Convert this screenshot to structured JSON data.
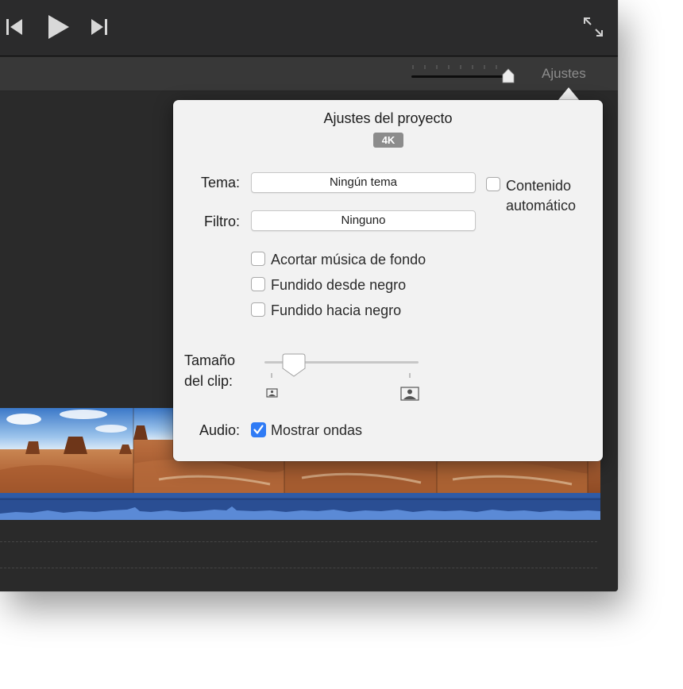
{
  "toolbar": {
    "icons": [
      "skip-back-icon",
      "play-icon",
      "skip-forward-icon",
      "fullscreen-icon"
    ]
  },
  "subbar": {
    "settings_label": "Ajustes",
    "zoom_level": 1.0
  },
  "popover": {
    "title": "Ajustes del proyecto",
    "badge": "4K",
    "theme_label": "Tema:",
    "theme_value": "Ningún tema",
    "filter_label": "Filtro:",
    "filter_value": "Ninguno",
    "auto_content_line1": "Contenido",
    "auto_content_line2": "automático",
    "auto_content_checked": false,
    "options": [
      {
        "label": "Acortar música de fondo",
        "checked": false
      },
      {
        "label": "Fundido desde negro",
        "checked": false
      },
      {
        "label": "Fundido hacia negro",
        "checked": false
      }
    ],
    "clip_size_label_line1": "Tamaño",
    "clip_size_label_line2": "del clip:",
    "clip_size_level": 0.2,
    "audio_label": "Audio:",
    "show_waveforms_label": "Mostrar ondas",
    "show_waveforms_checked": true
  },
  "colors": {
    "accent": "#2f7bf5",
    "waveform": "#2a4e93",
    "toolbar_bg": "#2b2b2c"
  }
}
